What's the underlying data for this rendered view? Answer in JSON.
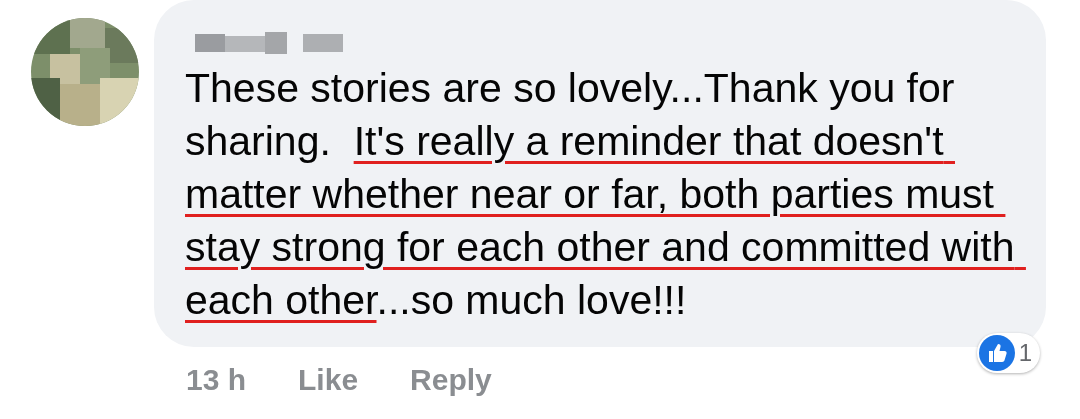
{
  "comment": {
    "author_blurred": true,
    "segments": [
      {
        "text": "These stories are so lovely...Thank you for sharing.  ",
        "underlined": false
      },
      {
        "text": "It's really a reminder that doesn't matter whether near or far, both parties must stay strong for each other and committed with each other",
        "underlined": true
      },
      {
        "text": "...so much love!!!",
        "underlined": false
      }
    ],
    "time": "13 h",
    "actions": [
      "Like",
      "Reply"
    ],
    "reaction_count": "1"
  }
}
